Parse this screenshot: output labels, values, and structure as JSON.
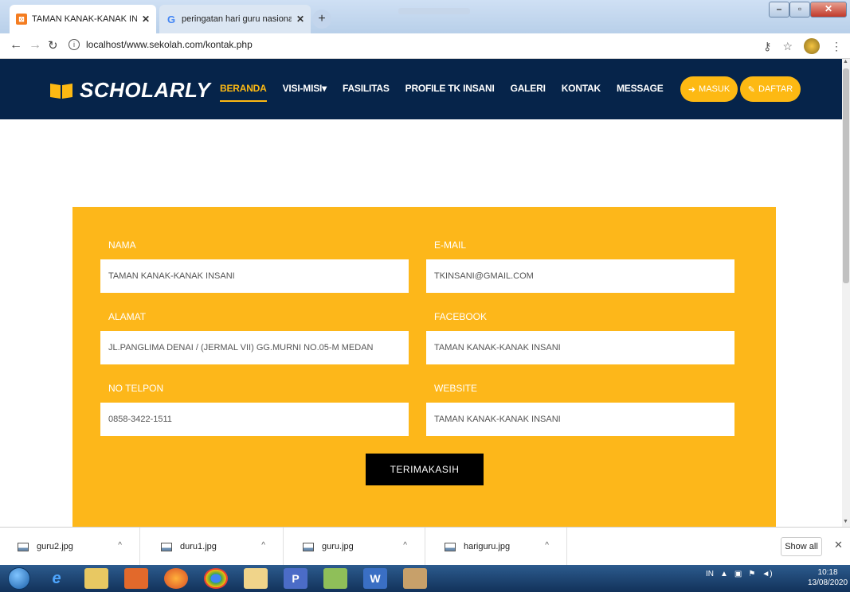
{
  "browser": {
    "tabs": [
      {
        "title": "TAMAN KANAK-KANAK INSANI",
        "favicon": "xampp-icon",
        "active": true
      },
      {
        "title": "peringatan hari guru nasional an",
        "favicon": "google-icon",
        "active": false
      }
    ],
    "new_tab": "+",
    "url": "localhost/www.sekolah.com/kontak.php"
  },
  "site": {
    "logo": "SCHOLARLY",
    "menu": [
      {
        "label": "BERANDA",
        "active": true
      },
      {
        "label": "VISI-MISI",
        "dropdown": true
      },
      {
        "label": "FASILITAS"
      },
      {
        "label": "PROFILE TK INSANI"
      },
      {
        "label": "GALERI"
      },
      {
        "label": "KONTAK"
      },
      {
        "label": "MESSAGE"
      }
    ],
    "login_label": "MASUK",
    "register_label": "DAFTAR",
    "colors": {
      "nav_bg": "#06244a",
      "accent": "#fdb913",
      "form_bg": "#fdb71a"
    }
  },
  "form": {
    "nama_label": "NAMA",
    "nama_value": "TAMAN KANAK-KANAK INSANI",
    "email_label": "E-MAIL",
    "email_value": "TKINSANI@GMAIL.COM",
    "alamat_label": "ALAMAT",
    "alamat_value": "JL.PANGLIMA DENAI / (JERMAL VII) GG.MURNI NO.05-M MEDAN",
    "facebook_label": "FACEBOOK",
    "facebook_value": "TAMAN KANAK-KANAK INSANI",
    "telpon_label": "NO TELPON",
    "telpon_value": "0858-3422-1511",
    "website_label": "WEBSITE",
    "website_value": "TAMAN KANAK-KANAK INSANI",
    "submit_label": "TERIMAKASIH"
  },
  "downloads": {
    "items": [
      "guru2.jpg",
      "duru1.jpg",
      "guru.jpg",
      "hariguru.jpg"
    ],
    "show_all": "Show all"
  },
  "taskbar": {
    "lang": "IN",
    "time": "10:18",
    "date": "13/08/2020"
  }
}
